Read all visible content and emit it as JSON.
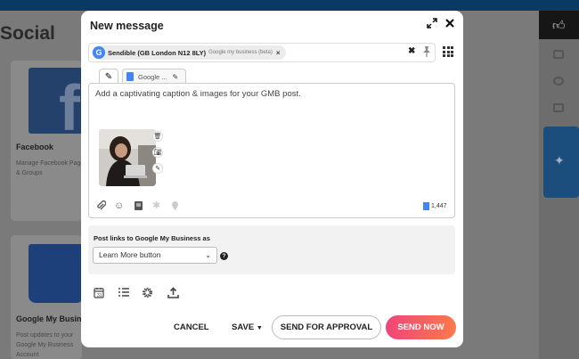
{
  "background": {
    "page_title": "Social",
    "cards": [
      {
        "name": "Facebook",
        "desc": "Manage Facebook Pages & Groups"
      },
      {
        "name": "Google My Business",
        "desc": "Post updates to your Google My Business Account"
      }
    ]
  },
  "modal": {
    "title": "New message",
    "expand_icon": "expand-icon",
    "close_icon": "close-icon",
    "account_chip": {
      "avatar_letter": "G",
      "name": "Sendible (GB London N12 8LY)",
      "type": "Google my business (beta)",
      "remove": "×"
    },
    "clear_all": "✖",
    "tabs": [
      {
        "icon": "pencil-icon"
      },
      {
        "label": "Google ..."
      }
    ],
    "caption_placeholder": "Add a captivating caption & images for your GMB post.",
    "char_count": "1,447",
    "post_links": {
      "label": "Post links to Google My Business as",
      "selected": "Learn More button",
      "help": "?"
    },
    "buttons": {
      "cancel": "CANCEL",
      "save": "SAVE",
      "send_for_approval": "SEND FOR APPROVAL",
      "send_now": "SEND NOW"
    }
  },
  "colors": {
    "send_now_gradient_start": "#f0457a",
    "send_now_gradient_end": "#fb7a4a",
    "google_blue": "#4285f4"
  }
}
